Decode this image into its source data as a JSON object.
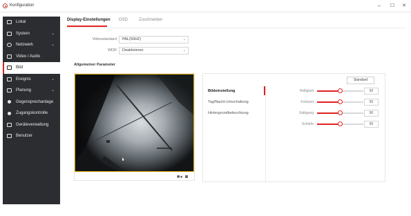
{
  "window": {
    "title": "Konfiguration",
    "min": "–",
    "max": "☐",
    "close": "✕"
  },
  "sidebar": {
    "items": [
      {
        "label": "Lokal",
        "icon": "monitor-icon"
      },
      {
        "label": "System",
        "icon": "system-icon",
        "chevron": "⌄"
      },
      {
        "label": "Netzwerk",
        "icon": "network-icon",
        "chevron": "⌄"
      },
      {
        "label": "Video / Audio",
        "icon": "video-icon"
      },
      {
        "label": "Bild",
        "icon": "image-icon",
        "active": true
      },
      {
        "label": "Ereignis",
        "icon": "event-icon",
        "chevron": "⌄"
      },
      {
        "label": "Planung",
        "icon": "calendar-icon",
        "chevron": "⌄"
      },
      {
        "label": "Gegensprechanlage",
        "icon": "intercom-icon"
      },
      {
        "label": "Zugangskontrolle",
        "icon": "lock-icon"
      },
      {
        "label": "Geräteverwaltung",
        "icon": "device-icon"
      },
      {
        "label": "Benutzer",
        "icon": "user-icon"
      }
    ]
  },
  "tabs": [
    {
      "label": "Display-Einstellungen",
      "active": true
    },
    {
      "label": "OSD"
    },
    {
      "label": "Zuschneiden"
    }
  ],
  "form": {
    "videostandard_label": "Videostandard",
    "videostandard_value": "PAL(50HZ)",
    "wdr_label": "WDR",
    "wdr_value": "Deaktivieren"
  },
  "section": {
    "title": "Allgemeiner Parameter"
  },
  "video_toolbar": {
    "record_icon": "■◂",
    "snapshot_icon": "◙"
  },
  "settings": {
    "standard_button": "Standard",
    "menu": [
      {
        "label": "Bildeinstellung",
        "active": true
      },
      {
        "label": "Tag/Nacht-Umschaltung"
      },
      {
        "label": "Hintergrundbeleuchtung"
      }
    ],
    "sliders": [
      {
        "label": "Helligkeit",
        "value": "50",
        "fraction": 0.5
      },
      {
        "label": "Kontrast",
        "value": "50",
        "fraction": 0.5
      },
      {
        "label": "Sättigung",
        "value": "50",
        "fraction": 0.5
      },
      {
        "label": "Schärfe",
        "value": "50",
        "fraction": 0.5
      }
    ]
  },
  "colors": {
    "accent": "#e02020",
    "sidebar_bg": "#2b2d31",
    "video_border": "#d9a400"
  }
}
